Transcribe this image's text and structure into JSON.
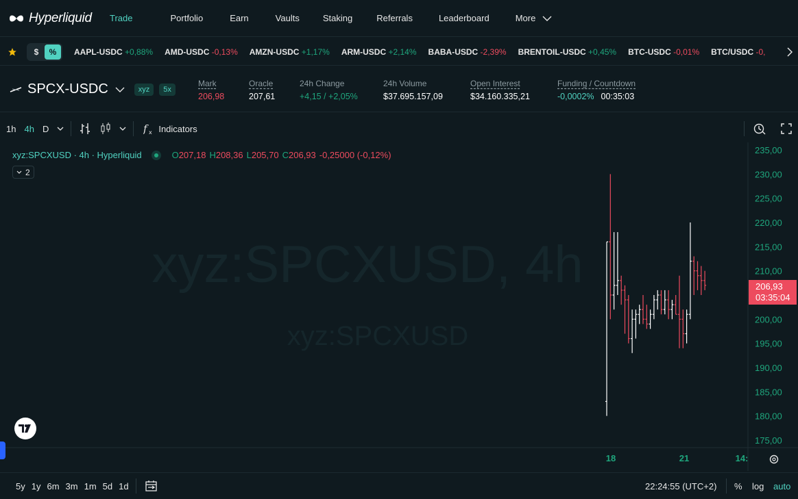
{
  "nav": {
    "brand": "Hyperliquid",
    "items": [
      "Trade",
      "Portfolio",
      "Earn",
      "Vaults",
      "Staking",
      "Referrals",
      "Leaderboard"
    ],
    "more": "More"
  },
  "ticker": {
    "toggle_dollar": "$",
    "toggle_percent": "%",
    "items": [
      {
        "sym": "AAPL-USDC",
        "chg": "+0,88%",
        "dir": "up"
      },
      {
        "sym": "AMD-USDC",
        "chg": "-0,13%",
        "dir": "down"
      },
      {
        "sym": "AMZN-USDC",
        "chg": "+1,17%",
        "dir": "up"
      },
      {
        "sym": "ARM-USDC",
        "chg": "+2,14%",
        "dir": "up"
      },
      {
        "sym": "BABA-USDC",
        "chg": "-2,39%",
        "dir": "down"
      },
      {
        "sym": "BRENTOIL-USDC",
        "chg": "+0,45%",
        "dir": "up"
      },
      {
        "sym": "BTC-USDC",
        "chg": "-0,01%",
        "dir": "down"
      },
      {
        "sym": "BTC/USDC",
        "chg": "-0,",
        "dir": "down"
      }
    ]
  },
  "market": {
    "pair": "SPCX-USDC",
    "badge_dex": "xyz",
    "badge_lev": "5x",
    "mark_label": "Mark",
    "mark": "206,98",
    "oracle_label": "Oracle",
    "oracle": "207,61",
    "change_label": "24h Change",
    "change": "+4,15 / +2,05%",
    "volume_label": "24h Volume",
    "volume": "$37.695.157,09",
    "oi_label": "Open Interest",
    "oi": "$34.160.335,21",
    "funding_label": "Funding / Countdown",
    "funding": "-0,0002%",
    "countdown": "00:35:03"
  },
  "toolbar": {
    "intervals": [
      "1h",
      "4h",
      "D"
    ],
    "indicators": "Indicators"
  },
  "chart": {
    "legend_title": "xyz:SPCXUSD · 4h · Hyperliquid",
    "o_label": "O",
    "o": "207,18",
    "h_label": "H",
    "h": "208,36",
    "l_label": "L",
    "l": "205,70",
    "c_label": "C",
    "c": "206,93",
    "chg": "-0,25000 (-0,12%)",
    "collapse_count": "2",
    "watermark_big": "xyz:SPCXUSD, 4h",
    "watermark_small": "xyz:SPCXUSD",
    "price_tag": "206,93",
    "price_tag_time": "03:35:04",
    "y_ticks": [
      "235,00",
      "230,00",
      "225,00",
      "220,00",
      "215,00",
      "210,00",
      "205,00",
      "200,00",
      "195,00",
      "190,00",
      "185,00",
      "180,00",
      "175,00"
    ],
    "x_ticks": [
      "18",
      "21",
      "14:"
    ],
    "colors": {
      "up": "#ffffff",
      "down": "#ed4b5e",
      "axis": "#1fa67d",
      "tag": "#ed4b5e"
    }
  },
  "chart_data": {
    "type": "ohlc",
    "ylim": [
      175,
      235
    ],
    "bars": [
      {
        "o": 183,
        "h": 216,
        "l": 180,
        "c": 216
      },
      {
        "o": 216,
        "h": 230,
        "l": 200,
        "c": 205
      },
      {
        "o": 205,
        "h": 218,
        "l": 202,
        "c": 207
      },
      {
        "o": 207,
        "h": 218,
        "l": 205,
        "c": 208
      },
      {
        "o": 208,
        "h": 209,
        "l": 203,
        "c": 206
      },
      {
        "o": 206,
        "h": 207,
        "l": 197,
        "c": 204
      },
      {
        "o": 204,
        "h": 205,
        "l": 195,
        "c": 196
      },
      {
        "o": 196,
        "h": 202,
        "l": 193,
        "c": 200
      },
      {
        "o": 200,
        "h": 202,
        "l": 196,
        "c": 201
      },
      {
        "o": 201,
        "h": 203,
        "l": 199,
        "c": 202
      },
      {
        "o": 202,
        "h": 205,
        "l": 199,
        "c": 200
      },
      {
        "o": 200,
        "h": 203,
        "l": 198,
        "c": 199
      },
      {
        "o": 199,
        "h": 202,
        "l": 198,
        "c": 201
      },
      {
        "o": 201,
        "h": 205,
        "l": 200,
        "c": 204
      },
      {
        "o": 204,
        "h": 206,
        "l": 202,
        "c": 205
      },
      {
        "o": 205,
        "h": 206,
        "l": 201,
        "c": 202
      },
      {
        "o": 202,
        "h": 206,
        "l": 201,
        "c": 204
      },
      {
        "o": 204,
        "h": 206,
        "l": 200,
        "c": 202
      },
      {
        "o": 202,
        "h": 204,
        "l": 200,
        "c": 203
      },
      {
        "o": 203,
        "h": 205,
        "l": 201,
        "c": 201
      },
      {
        "o": 201,
        "h": 209,
        "l": 194,
        "c": 200
      },
      {
        "o": 200,
        "h": 202,
        "l": 194,
        "c": 197
      },
      {
        "o": 197,
        "h": 202,
        "l": 195,
        "c": 201
      },
      {
        "o": 201,
        "h": 220,
        "l": 200,
        "c": 212
      },
      {
        "o": 212,
        "h": 213,
        "l": 205,
        "c": 210
      },
      {
        "o": 210,
        "h": 212,
        "l": 206,
        "c": 209
      },
      {
        "o": 209,
        "h": 211,
        "l": 205,
        "c": 208
      },
      {
        "o": 208,
        "h": 210,
        "l": 206,
        "c": 207
      }
    ]
  },
  "bottom": {
    "ranges": [
      "5y",
      "1y",
      "6m",
      "3m",
      "1m",
      "5d",
      "1d"
    ],
    "clock": "22:24:55 (UTC+2)",
    "pct": "%",
    "log": "log",
    "auto": "auto"
  }
}
